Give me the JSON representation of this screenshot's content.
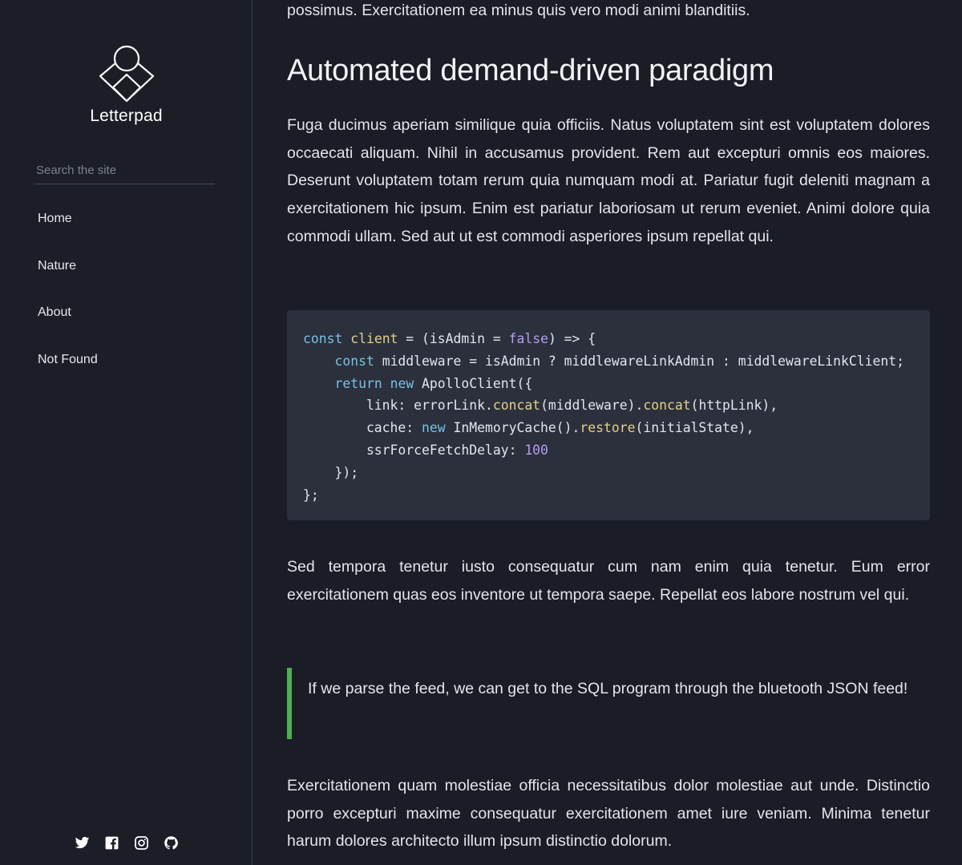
{
  "sidebar": {
    "logo_text": "Letterpad",
    "search_placeholder": "Search the site",
    "nav": [
      {
        "label": "Home"
      },
      {
        "label": "Nature"
      },
      {
        "label": "About"
      },
      {
        "label": "Not Found"
      }
    ],
    "social": [
      "twitter-icon",
      "facebook-icon",
      "instagram-icon",
      "github-icon"
    ]
  },
  "main": {
    "top_text": "possimus. Exercitationem ea minus quis vero modi animi blanditiis.",
    "heading": "Automated demand-driven paradigm",
    "paragraph_1": "Fuga ducimus aperiam similique quia officiis. Natus voluptatem sint est voluptatem dolores occaecati aliquam. Nihil in accusamus provident. Rem aut excepturi omnis eos maiores. Deserunt voluptatem totam rerum quia numquam modi at. Pariatur fugit deleniti magnam a exercitationem hic ipsum. Enim est pariatur laboriosam ut rerum eveniet. Animi dolore quia commodi ullam. Sed aut ut est commodi asperiores ipsum repellat qui.",
    "code_lines": [
      "const client = (isAdmin = false) => {",
      "    const middleware = isAdmin ? middlewareLinkAdmin : middlewareLinkClient;",
      "    return new ApolloClient({",
      "        link: errorLink.concat(middleware).concat(httpLink),",
      "        cache: new InMemoryCache().restore(initialState),",
      "        ssrForceFetchDelay: 100",
      "    });",
      "};"
    ],
    "paragraph_2": "Sed tempora tenetur iusto consequatur cum nam enim quia tenetur. Eum error exercitationem quas eos inventore ut tempora saepe. Repellat eos labore nostrum vel qui.",
    "blockquote": "If we parse the feed, we can get to the SQL program through the bluetooth JSON feed!",
    "paragraph_3": "Exercitationem quam molestiae officia necessitatibus dolor molestiae aut unde. Distinctio porro excepturi maxime consequatur exercitationem amet iure veniam. Minima tenetur harum dolores architecto illum ipsum distinctio dolorum."
  },
  "colors": {
    "background": "#1a1d26",
    "code_background": "#2b303c",
    "blockquote_accent": "#4caf50",
    "keyword": "#79c0e6",
    "function": "#e5cf8a",
    "literal": "#b69cf0"
  }
}
